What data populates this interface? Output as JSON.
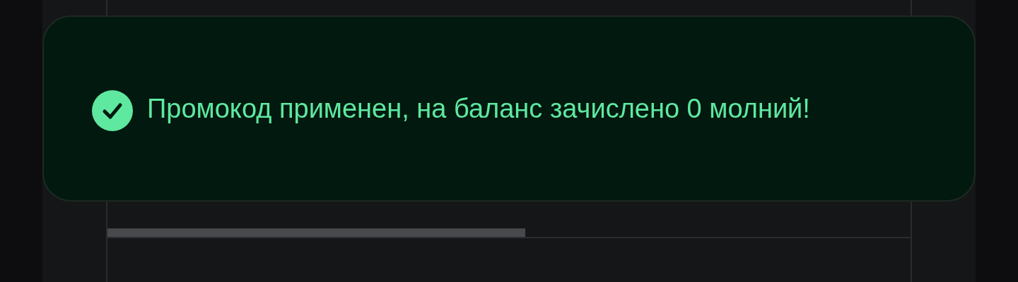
{
  "toast": {
    "kind": "success",
    "message": "Промокод применен, на баланс зачислено 0 молний!"
  },
  "progress": {
    "level": 0.52
  }
}
